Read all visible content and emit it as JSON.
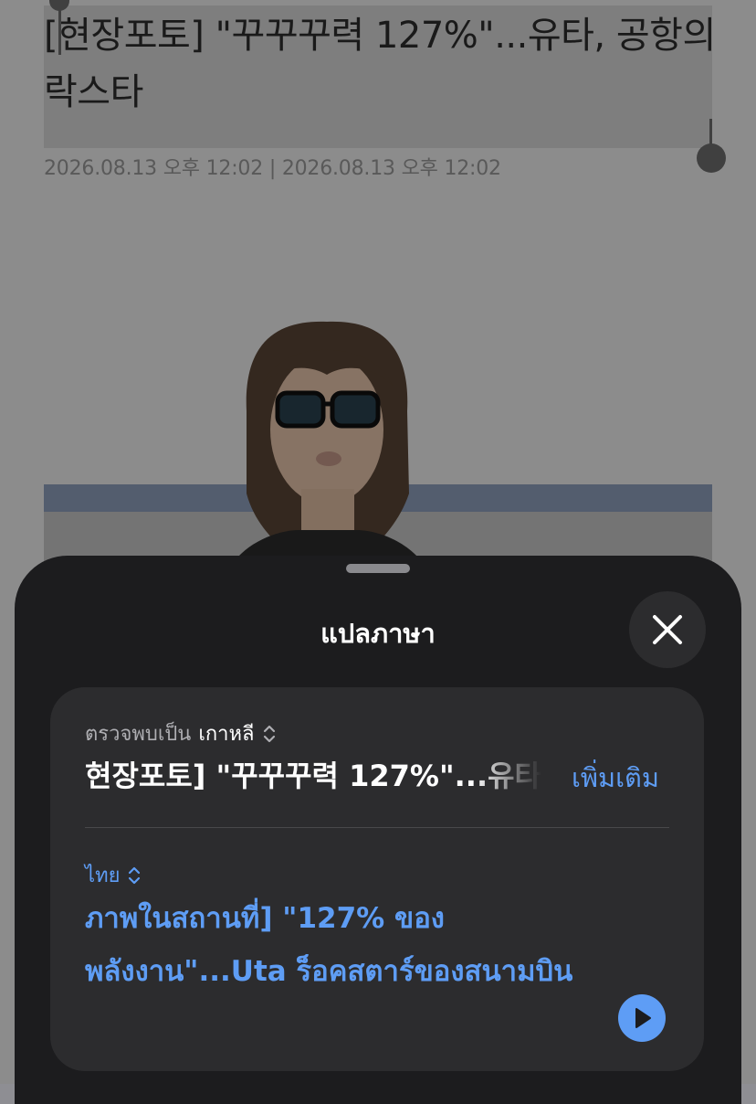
{
  "article": {
    "headline": "[현장포토] \"꾸꾸꾸력 127%\"...유타, 공항의 락스타",
    "timestamp": "2026.08.13 오후 12:02 | 2026.08.13 오후 12:02"
  },
  "sheet": {
    "title": "แปลภาษา",
    "close_icon": "close-icon",
    "source": {
      "detected_label": "ตรวจพบเป็น",
      "language": "เกาหลี",
      "text": "현장포토] \"꾸꾸꾸력 127%\"...유타",
      "more_label": "เพิ่มเติม"
    },
    "target": {
      "language": "ไทย",
      "text": "ภาพในสถานที่] \"127% ของพลังงาน\"...Uta ร็อคสตาร์ของสนามบิน",
      "play_icon": "play-icon"
    }
  },
  "colors": {
    "accent": "#5e9df5",
    "sheet_bg": "#1c1c1e",
    "card_bg": "#2c2c2e"
  }
}
